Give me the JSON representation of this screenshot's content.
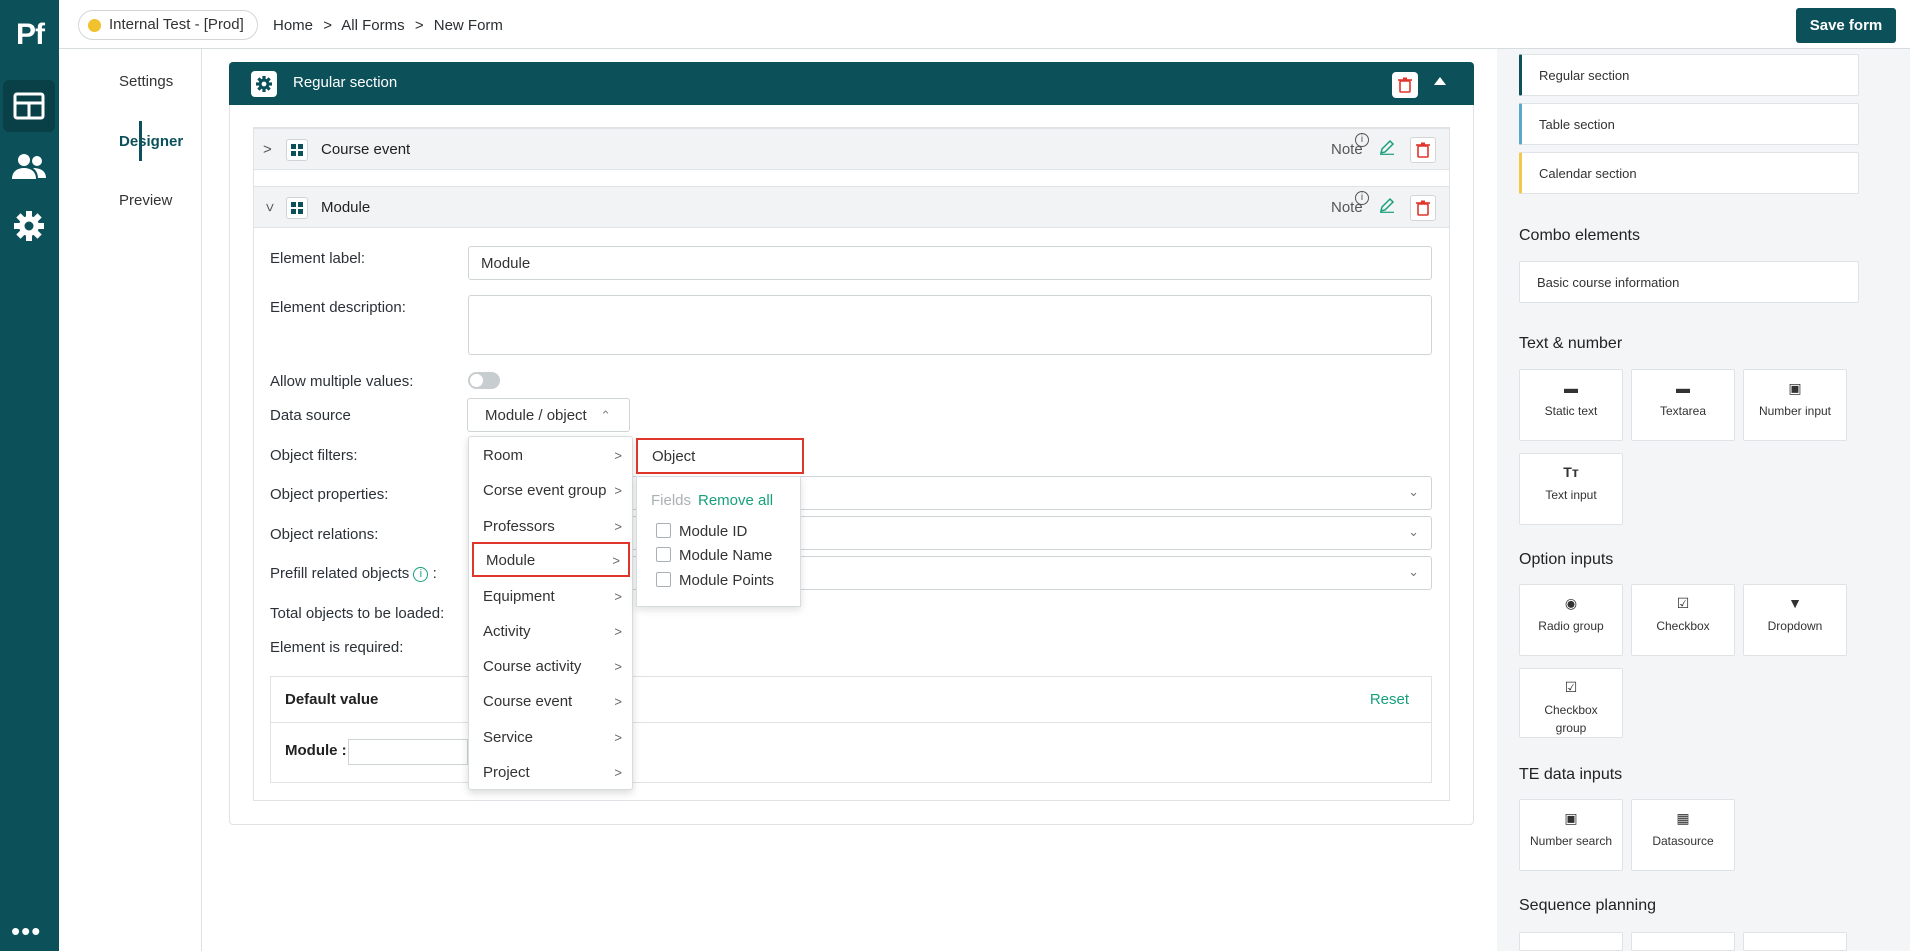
{
  "rail": {
    "logo": "Pf",
    "more": "•••"
  },
  "topbar": {
    "environment": "Internal Test - [Prod]",
    "breadcrumbs": [
      "Home",
      ">",
      "All Forms",
      ">",
      "New Form"
    ],
    "save_label": "Save form",
    "colors": {
      "brand": "#0c5159",
      "env_dot": "#f2c12e"
    }
  },
  "tabs": [
    "Settings",
    "Designer",
    "Preview"
  ],
  "section": {
    "title": "Regular section"
  },
  "elements": [
    {
      "title": "Course event",
      "note": "Note"
    },
    {
      "title": "Module",
      "note": "Note"
    }
  ],
  "form": {
    "label_caption": "Element label:",
    "label_value": "Module",
    "description_caption": "Element description:",
    "multiple_caption": "Allow multiple values:",
    "datasource_caption": "Data source",
    "datasource_value": "Module / object",
    "object_filters": "Object filters:",
    "object_properties": "Object properties:",
    "object_relations": "Object relations:",
    "prefill": "Prefill related objects",
    "prefill_colon": ":",
    "total_objects": "Total objects to be loaded:",
    "required": "Element is required:",
    "default_value": "Default value",
    "reset": "Reset",
    "module_field": "Module :"
  },
  "datasource_menu": [
    "Room",
    "Corse event group",
    "Professors",
    "Module",
    "Equipment",
    "Activity",
    "Course activity",
    "Course event",
    "Service",
    "Project"
  ],
  "submenu": {
    "object_label": "Object",
    "fields_label": "Fields",
    "remove_all": "Remove all",
    "fields": [
      "Module ID",
      "Module Name",
      "Module Points"
    ]
  },
  "palette": {
    "sections": [
      "Regular section",
      "Table section",
      "Calendar section"
    ],
    "combo_title": "Combo elements",
    "combo_items": [
      "Basic course information"
    ],
    "text_title": "Text & number",
    "text_items": [
      "Static text",
      "Textarea",
      "Number input",
      "Text input"
    ],
    "option_title": "Option inputs",
    "option_items": [
      "Radio group",
      "Checkbox",
      "Dropdown",
      "Checkbox group"
    ],
    "te_title": "TE data inputs",
    "te_items": [
      "Number search",
      "Datasource"
    ],
    "seq_title": "Sequence planning"
  }
}
